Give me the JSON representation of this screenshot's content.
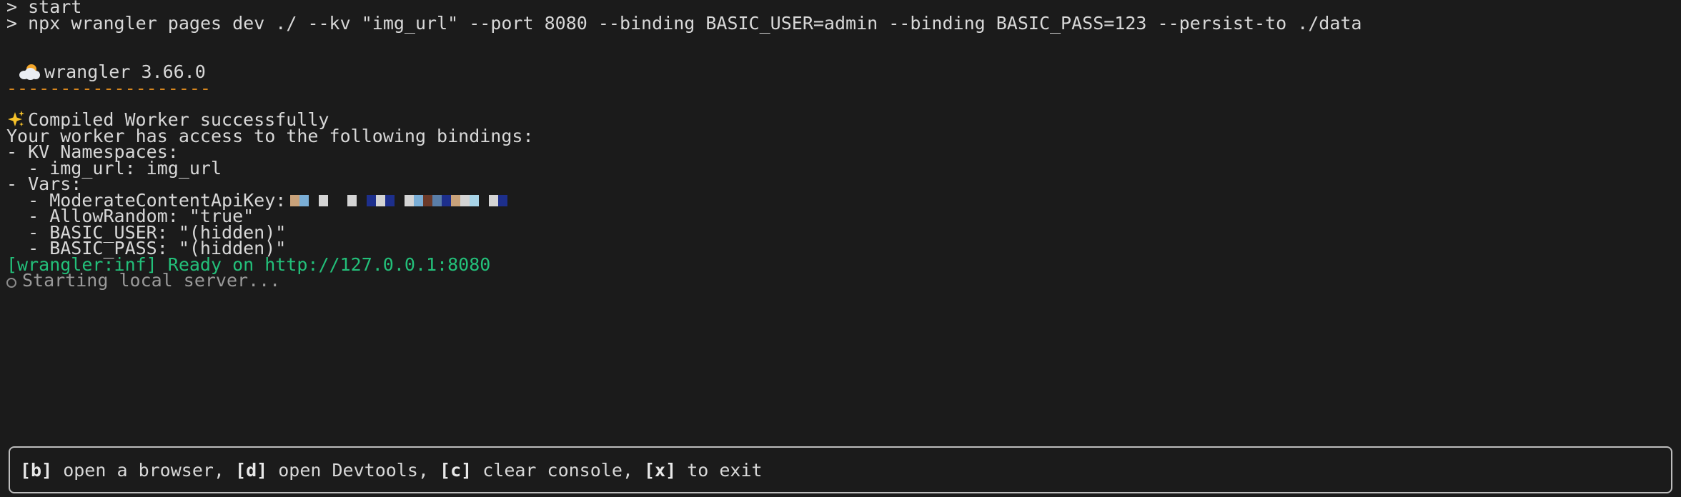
{
  "terminal": {
    "cmd1_prompt": ">",
    "cmd1": "start",
    "cmd2_prompt": ">",
    "cmd2": "npx wrangler pages dev ./ --kv \"img_url\" --port 8080 --binding BASIC_USER=admin --binding BASIC_PASS=123 --persist-to ./data",
    "wrangler_icon": "sun-behind-cloud-icon",
    "wrangler_version": "wrangler 3.66.0",
    "separator": "-------------------",
    "compiled_icon": "sparkles-icon",
    "compiled": "Compiled Worker successfully",
    "bindings_intro": "Your worker has access to the following bindings:",
    "kv_header": "- KV Namespaces:",
    "kv_item": "  - img_url: img_url",
    "vars_header": "- Vars:",
    "var_moderate": "  - ModerateContentApiKey:",
    "var_allow_random": "  - AllowRandom: \"true\"",
    "var_basic_user": "  - BASIC_USER: \"(hidden)\"",
    "var_basic_pass": "  - BASIC_PASS: \"(hidden)\"",
    "ready": "[wrangler:inf] Ready on http://127.0.0.1:8080",
    "spinner_icon": "spinner-circle-icon",
    "starting": "Starting local server..."
  },
  "hotkeys": {
    "b_key": "[b]",
    "b_label": " open a browser, ",
    "d_key": "[d]",
    "d_label": " open Devtools, ",
    "c_key": "[c]",
    "c_label": " clear console, ",
    "x_key": "[x]",
    "x_label": " to exit"
  },
  "colors": {
    "background": "#1b1b1b",
    "text": "#cccccc",
    "separator": "#d7861e",
    "ready": "#23c07a",
    "muted": "#9a9a9a"
  }
}
